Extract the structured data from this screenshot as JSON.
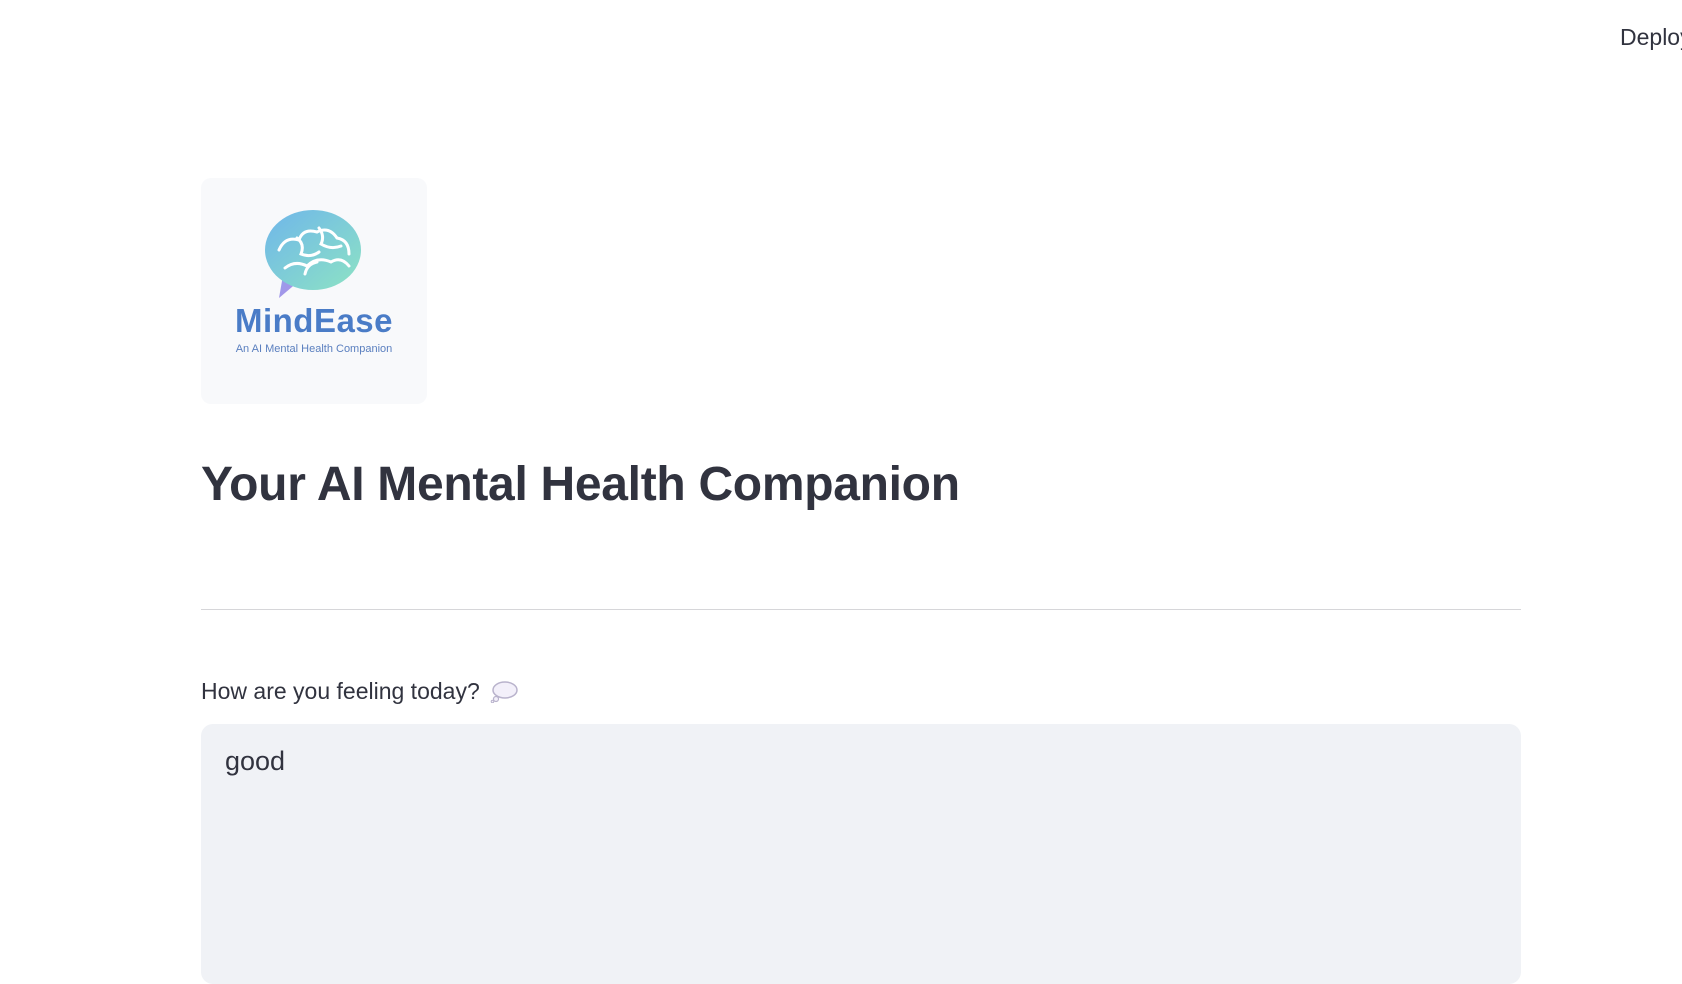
{
  "toolbar": {
    "deploy_label": "Deploy"
  },
  "logo": {
    "name": "MindEase",
    "tagline": "An AI Mental Health Companion",
    "colors": {
      "brain_start": "#7cc4e8",
      "brain_end": "#8be0c8",
      "bubble_tail": "#a98be6",
      "name": "#4a7cc7"
    }
  },
  "page": {
    "title": "Your AI Mental Health Companion"
  },
  "feeling_field": {
    "label": "How are you feeling today?",
    "icon": "thought-balloon-icon",
    "value": "good"
  },
  "colors": {
    "text": "#31333f",
    "input_background": "#f0f2f6",
    "divider": "#d6d6d9"
  }
}
